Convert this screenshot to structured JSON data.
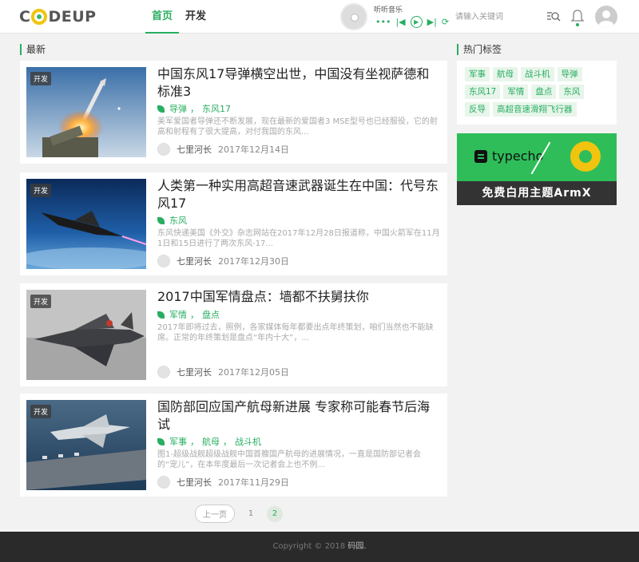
{
  "header": {
    "logo_text": "CODEUP",
    "nav": [
      {
        "label": "首页",
        "active": true
      },
      {
        "label": "开发",
        "active": false
      }
    ],
    "music": {
      "title": "听听音乐"
    },
    "search": {
      "placeholder": "请输入关键词"
    }
  },
  "main": {
    "section_title": "最新",
    "posts": [
      {
        "badge": "开发",
        "title": "中国东风17导弹横空出世，中国没有坐视萨德和标准3",
        "tags": [
          "导弹",
          "东风17"
        ],
        "excerpt": "美军爱国者导弹还不断发展，现在最新的爱国者3 MSE型号也已经服役，它的射高和射程有了很大提高，对付我国的东风...",
        "author": "七里河长",
        "date": "2017年12月14日"
      },
      {
        "badge": "开发",
        "title": "人类第一种实用高超音速武器诞生在中国：代号东风17",
        "tags": [
          "东风"
        ],
        "excerpt": "东风快递美国《外交》杂志网站在2017年12月28日报道称，中国火箭军在11月1日和15日进行了两次东风-17...",
        "author": "七里河长",
        "date": "2017年12月30日"
      },
      {
        "badge": "开发",
        "title": "2017中国军情盘点：墙都不扶舅扶你",
        "tags": [
          "军情",
          "盘点"
        ],
        "excerpt": "2017年即将过去，照例，各家媒体每年都要出点年终策划，咱们当然也不能缺席。正常的年终策划是盘点“年内十大”，...",
        "author": "七里河长",
        "date": "2017年12月05日"
      },
      {
        "badge": "开发",
        "title": "国防部回应国产航母新进展 专家称可能春节后海试",
        "tags": [
          "军事",
          "航母",
          "战斗机"
        ],
        "excerpt": "图1-超级战舰超级战舰中国首艘国产航母的进展情况，一直是国防部记者会的“宠儿”，在本年度最后一次记者会上也不例...",
        "author": "七里河长",
        "date": "2017年11月29日"
      }
    ],
    "pager": {
      "prev": "上一页",
      "pages": [
        "1",
        "2"
      ],
      "current": "2"
    }
  },
  "sidebar": {
    "hot_tags_title": "热门标签",
    "hot_tags": [
      "军事",
      "航母",
      "战斗机",
      "导弹",
      "东风17",
      "军情",
      "盘点",
      "东风",
      "反导",
      "高超音速滑翔飞行器"
    ],
    "ad": {
      "brand": "typecho",
      "caption": "免费白用主题ArmX"
    }
  },
  "footer": {
    "copyright": "Copyright © 2018",
    "site": "码园."
  },
  "colors": {
    "accent": "#27ae60",
    "ad_green": "#2ebd59",
    "footer_bg": "#2a2a2a"
  }
}
